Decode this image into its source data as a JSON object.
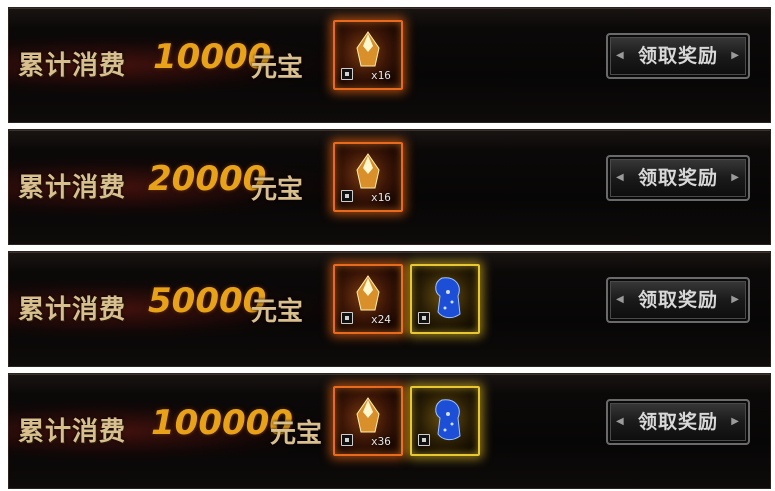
{
  "rows": [
    {
      "label": "累计消费",
      "amount": "10000",
      "unit": "元宝",
      "items": [
        {
          "type": "ember-crystal",
          "qty": "x16"
        }
      ],
      "button": "领取奖励"
    },
    {
      "label": "累计消费",
      "amount": "20000",
      "unit": "元宝",
      "items": [
        {
          "type": "ember-crystal",
          "qty": "x16"
        }
      ],
      "button": "领取奖励"
    },
    {
      "label": "累计消费",
      "amount": "50000",
      "unit": "元宝",
      "items": [
        {
          "type": "ember-crystal",
          "qty": "x24"
        },
        {
          "type": "blue-cloak",
          "qty": ""
        }
      ],
      "button": "领取奖励"
    },
    {
      "label": "累计消费",
      "amount": "100000",
      "unit": "元宝",
      "items": [
        {
          "type": "ember-crystal",
          "qty": "x36"
        },
        {
          "type": "blue-cloak",
          "qty": ""
        }
      ],
      "button": "领取奖励"
    }
  ],
  "colors": {
    "amount": "#e8a21a",
    "label": "#d9bf8d",
    "frame_orange": "#e86a1c",
    "frame_gold": "#e8c830"
  }
}
